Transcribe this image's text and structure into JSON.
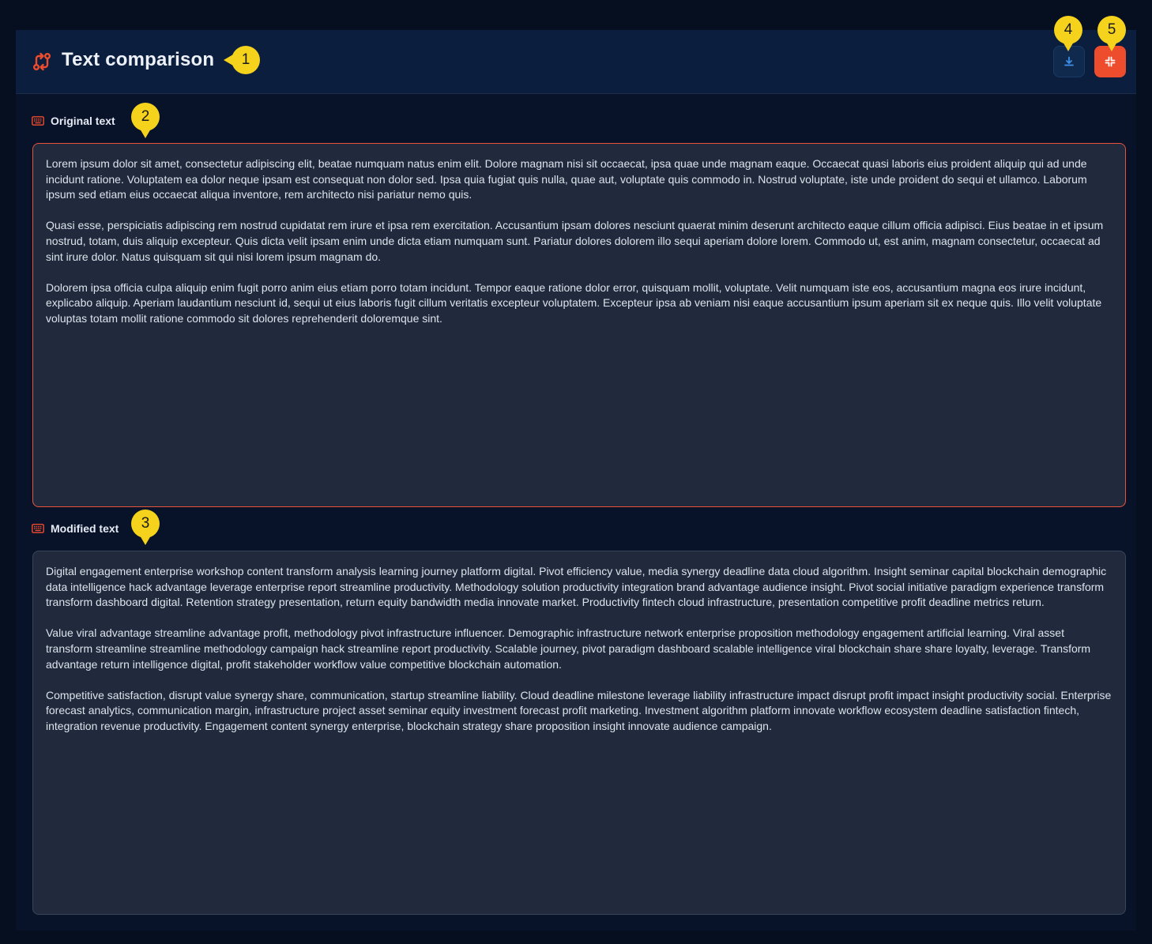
{
  "header": {
    "title": "Text comparison",
    "download_icon": "download-icon",
    "collapse_icon": "collapse-icon",
    "title_icon": "compare-arrows-icon"
  },
  "original": {
    "label": "Original text",
    "icon": "keyboard-icon",
    "paragraphs": [
      "Lorem ipsum dolor sit amet, consectetur adipiscing elit, beatae numquam natus enim elit. Dolore magnam nisi sit occaecat, ipsa quae unde magnam eaque. Occaecat quasi laboris eius proident aliquip qui ad unde incidunt ratione. Voluptatem ea dolor neque ipsam est consequat non dolor sed. Ipsa quia fugiat quis nulla, quae aut, voluptate quis commodo in. Nostrud voluptate, iste unde proident do sequi et ullamco. Laborum ipsum sed etiam eius occaecat aliqua inventore, rem architecto nisi pariatur nemo quis.",
      "Quasi esse, perspiciatis adipiscing rem nostrud cupidatat rem irure et ipsa rem exercitation. Accusantium ipsam dolores nesciunt quaerat minim deserunt architecto eaque cillum officia adipisci. Eius beatae in et ipsum nostrud, totam, duis aliquip excepteur. Quis dicta velit ipsam enim unde dicta etiam numquam sunt. Pariatur dolores dolorem illo sequi aperiam dolore lorem. Commodo ut, est anim, magnam consectetur, occaecat ad sint irure dolor. Natus quisquam sit qui nisi lorem ipsum magnam do.",
      "Dolorem ipsa officia culpa aliquip enim fugit porro anim eius etiam porro totam incidunt. Tempor eaque ratione dolor error, quisquam mollit, voluptate. Velit numquam iste eos, accusantium magna eos irure incidunt, explicabo aliquip. Aperiam laudantium nesciunt id, sequi ut eius laboris fugit cillum veritatis excepteur voluptatem. Excepteur ipsa ab veniam nisi eaque accusantium ipsum aperiam sit ex neque quis. Illo velit voluptate voluptas totam mollit ratione commodo sit dolores reprehenderit doloremque sint."
    ]
  },
  "modified": {
    "label": "Modified text",
    "icon": "keyboard-icon",
    "paragraphs": [
      "Digital engagement enterprise workshop content transform analysis learning journey platform digital. Pivot efficiency value, media synergy deadline data cloud algorithm. Insight seminar capital blockchain demographic data intelligence hack advantage leverage enterprise report streamline productivity. Methodology solution productivity integration brand advantage audience insight. Pivot social initiative paradigm experience transform transform dashboard digital. Retention strategy presentation, return equity bandwidth media innovate market. Productivity fintech cloud infrastructure, presentation competitive profit deadline metrics return.",
      "Value viral advantage streamline advantage profit, methodology pivot infrastructure influencer. Demographic infrastructure network enterprise proposition methodology engagement artificial learning. Viral asset transform streamline streamline methodology campaign hack streamline report productivity. Scalable journey, pivot paradigm dashboard scalable intelligence viral blockchain share share loyalty, leverage. Transform advantage return intelligence digital, profit stakeholder workflow value competitive blockchain automation.",
      "Competitive satisfaction, disrupt value synergy share, communication, startup streamline liability. Cloud deadline milestone leverage liability infrastructure impact disrupt profit impact insight productivity social. Enterprise forecast analytics, communication margin, infrastructure project asset seminar equity investment forecast profit marketing. Investment algorithm platform innovate workflow ecosystem deadline satisfaction fintech, integration revenue productivity. Engagement content synergy enterprise, blockchain strategy share proposition insight innovate audience campaign."
    ]
  },
  "markers": [
    "1",
    "2",
    "3",
    "4",
    "5"
  ],
  "colors": {
    "accent": "#ee4d2d",
    "marker": "#f5d21c",
    "background": "#060f1f",
    "header": "#0b1e3e",
    "textbox": "#212a3c"
  }
}
